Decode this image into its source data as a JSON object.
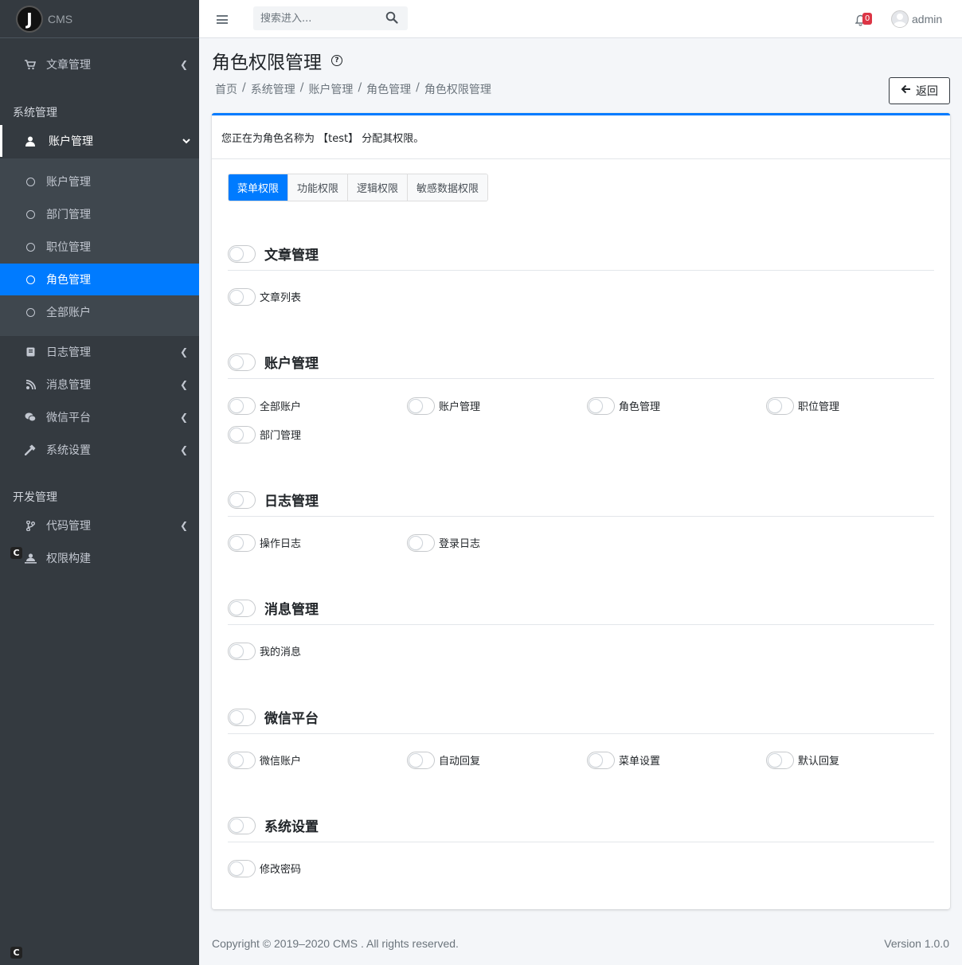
{
  "brand": {
    "logo": "J",
    "name": "CMS"
  },
  "sidebar": {
    "article": "文章管理",
    "section_system": "系统管理",
    "account": "账户管理",
    "account_sub": [
      "账户管理",
      "部门管理",
      "职位管理",
      "角色管理",
      "全部账户"
    ],
    "log": "日志管理",
    "message": "消息管理",
    "wechat": "微信平台",
    "settings": "系统设置",
    "section_dev": "开发管理",
    "code": "代码管理",
    "perm_build": "权限构建"
  },
  "topbar": {
    "search_placeholder": "搜索进入...",
    "notifications": "0",
    "user": "admin"
  },
  "page": {
    "title": "角色权限管理",
    "breadcrumb": [
      "首页",
      "系统管理",
      "账户管理",
      "角色管理",
      "角色权限管理"
    ],
    "back": "返回",
    "notice": "您正在为角色名称为 【test】 分配其权限。"
  },
  "tabs": [
    "菜单权限",
    "功能权限",
    "逻辑权限",
    "敏感数据权限"
  ],
  "groups": [
    {
      "title": "文章管理",
      "items": [
        "文章列表"
      ]
    },
    {
      "title": "账户管理",
      "items": [
        "全部账户",
        "账户管理",
        "角色管理",
        "职位管理",
        "部门管理"
      ]
    },
    {
      "title": "日志管理",
      "items": [
        "操作日志",
        "登录日志"
      ]
    },
    {
      "title": "消息管理",
      "items": [
        "我的消息"
      ]
    },
    {
      "title": "微信平台",
      "items": [
        "微信账户",
        "自动回复",
        "菜单设置",
        "默认回复"
      ]
    },
    {
      "title": "系统设置",
      "items": [
        "修改密码"
      ]
    }
  ],
  "footer": {
    "copyright": "Copyright © 2019–2020 CMS . All rights reserved.",
    "version": "Version 1.0.0"
  },
  "overlay_badge": "C",
  "colors": {
    "sidebar": "#343a40",
    "accent": "#007bff",
    "badge": "#dc3545"
  }
}
